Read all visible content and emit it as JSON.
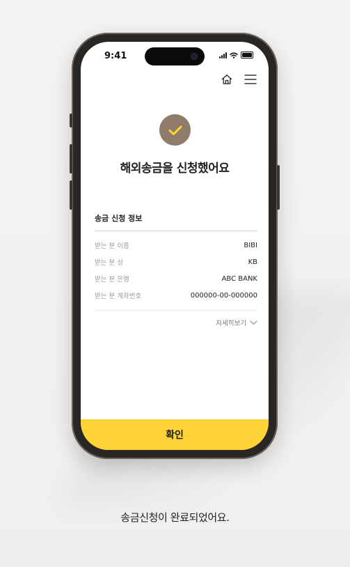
{
  "status_bar": {
    "time": "9:41"
  },
  "header": {
    "home_icon": "home-icon",
    "menu_icon": "hamburger-menu-icon"
  },
  "result": {
    "icon": "check-icon",
    "title": "해외송금을 신청했어요"
  },
  "details": {
    "section_title": "송금 신청 정보",
    "rows": [
      {
        "label": "받는 분 이름",
        "value": "BIBI"
      },
      {
        "label": "받는 분 성",
        "value": "KB"
      },
      {
        "label": "받는 분 은행",
        "value": "ABC BANK"
      },
      {
        "label": "받는 분 계좌번호",
        "value": "000000-00-000000"
      }
    ],
    "more_label": "자세히보기"
  },
  "footer": {
    "confirm_label": "확인"
  },
  "caption": "송금신청이 완료되었어요.",
  "colors": {
    "accent": "#ffd335",
    "check_circle": "#8f7d69",
    "check_mark": "#ffd335"
  }
}
